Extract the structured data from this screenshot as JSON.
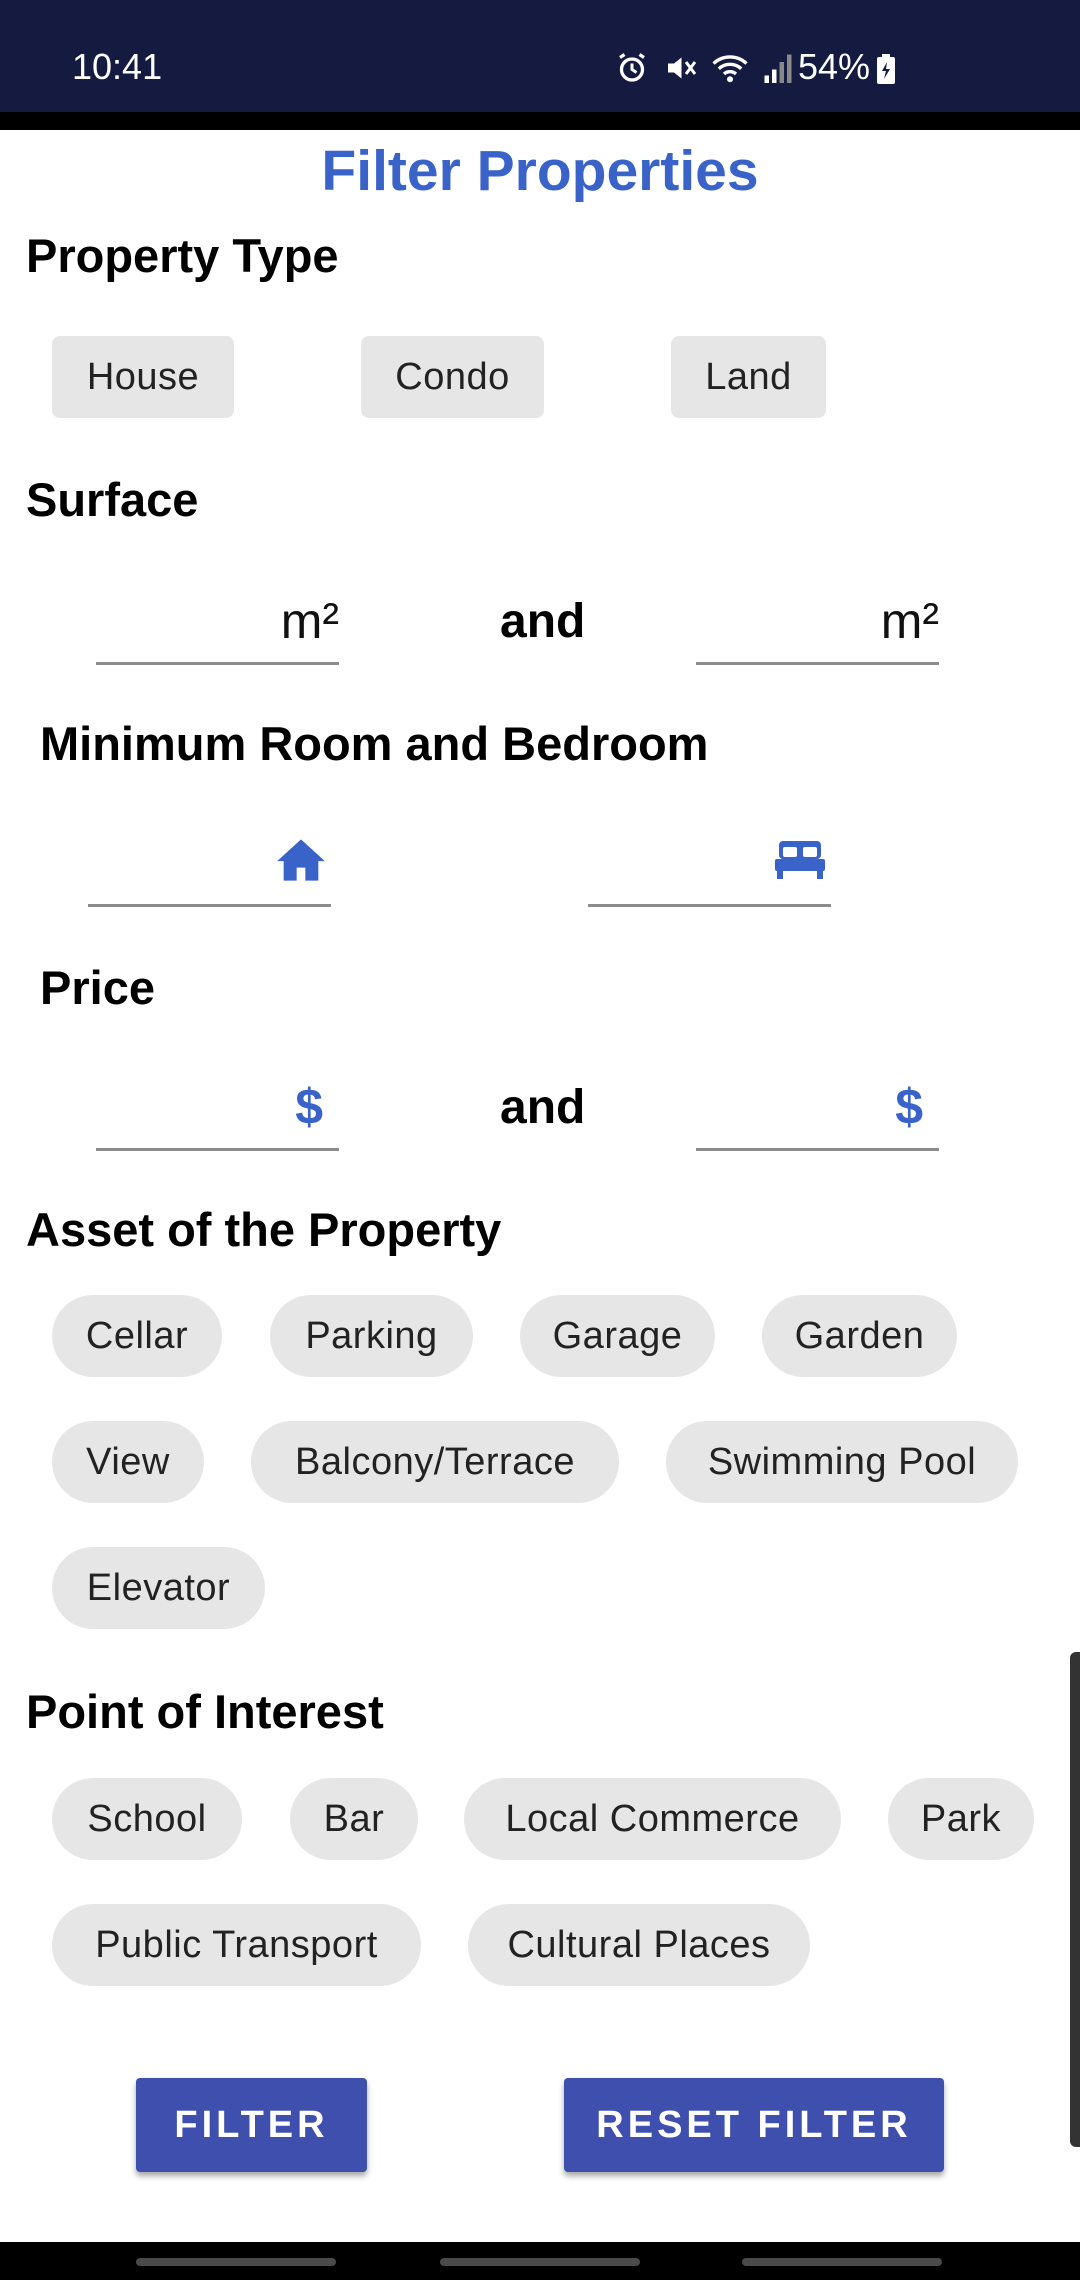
{
  "status_bar": {
    "time": "10:41",
    "battery": "54%"
  },
  "title": "Filter Properties",
  "property_type": {
    "heading": "Property Type",
    "chips": [
      "House",
      "Condo",
      "Land"
    ]
  },
  "surface": {
    "heading": "Surface",
    "unit": "m²",
    "and": "and"
  },
  "rooms": {
    "heading": "Minimum Room and Bedroom"
  },
  "price": {
    "heading": "Price",
    "unit": "$",
    "and": "and"
  },
  "assets": {
    "heading": "Asset of the Property",
    "chips": [
      "Cellar",
      "Parking",
      "Garage",
      "Garden",
      "View",
      "Balcony/Terrace",
      "Swimming Pool",
      "Elevator"
    ]
  },
  "poi": {
    "heading": "Point of Interest",
    "chips": [
      "School",
      "Bar",
      "Local Commerce",
      "Park",
      "Public Transport",
      "Cultural Places"
    ]
  },
  "buttons": {
    "filter": "FILTER",
    "reset": "RESET FILTER"
  },
  "colors": {
    "accent": "#3a63c9",
    "button": "#3f4fad",
    "status_bar": "#141a40",
    "chip": "#e6e6e6"
  }
}
